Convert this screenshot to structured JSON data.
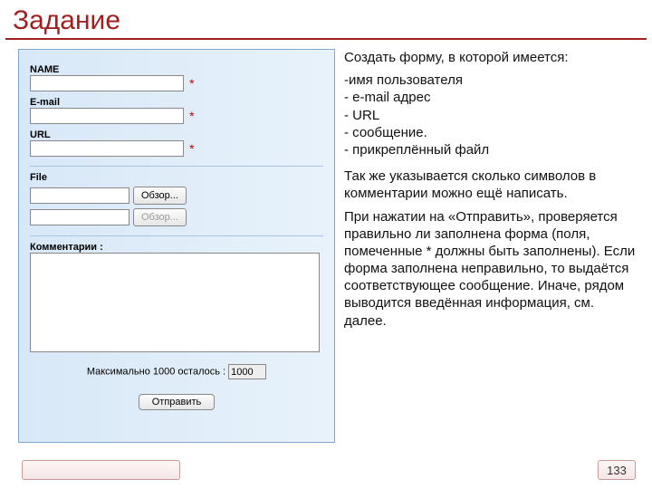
{
  "title": "Задание",
  "form": {
    "name_label": "NAME",
    "email_label": "E-mail",
    "url_label": "URL",
    "file_label": "File",
    "browse1": "Обзор...",
    "browse2": "Обзор...",
    "comment_label": "Комментарии :",
    "counter_prefix": "Максимально 1000 осталось :",
    "counter_value": "1000",
    "submit": "Отправить",
    "asterisk": "*"
  },
  "desc": {
    "intro": "Создать форму, в которой имеется:",
    "li1": "-имя пользователя",
    "li2": " - e-mail адрес",
    "li3": " - URL",
    "li4": " - сообщение.",
    "li5": "- прикреплённый файл",
    "p2": "Так же указывается сколько символов в комментарии можно ещё написать.",
    "p3": "При нажатии на «Отправить», проверяется правильно ли заполнена форма (поля, помеченные * должны быть заполнены). Если форма заполнена неправильно, то выдаётся соответствующее сообщение. Иначе, рядом выводится введённая информация, см. далее."
  },
  "page_number": "133"
}
